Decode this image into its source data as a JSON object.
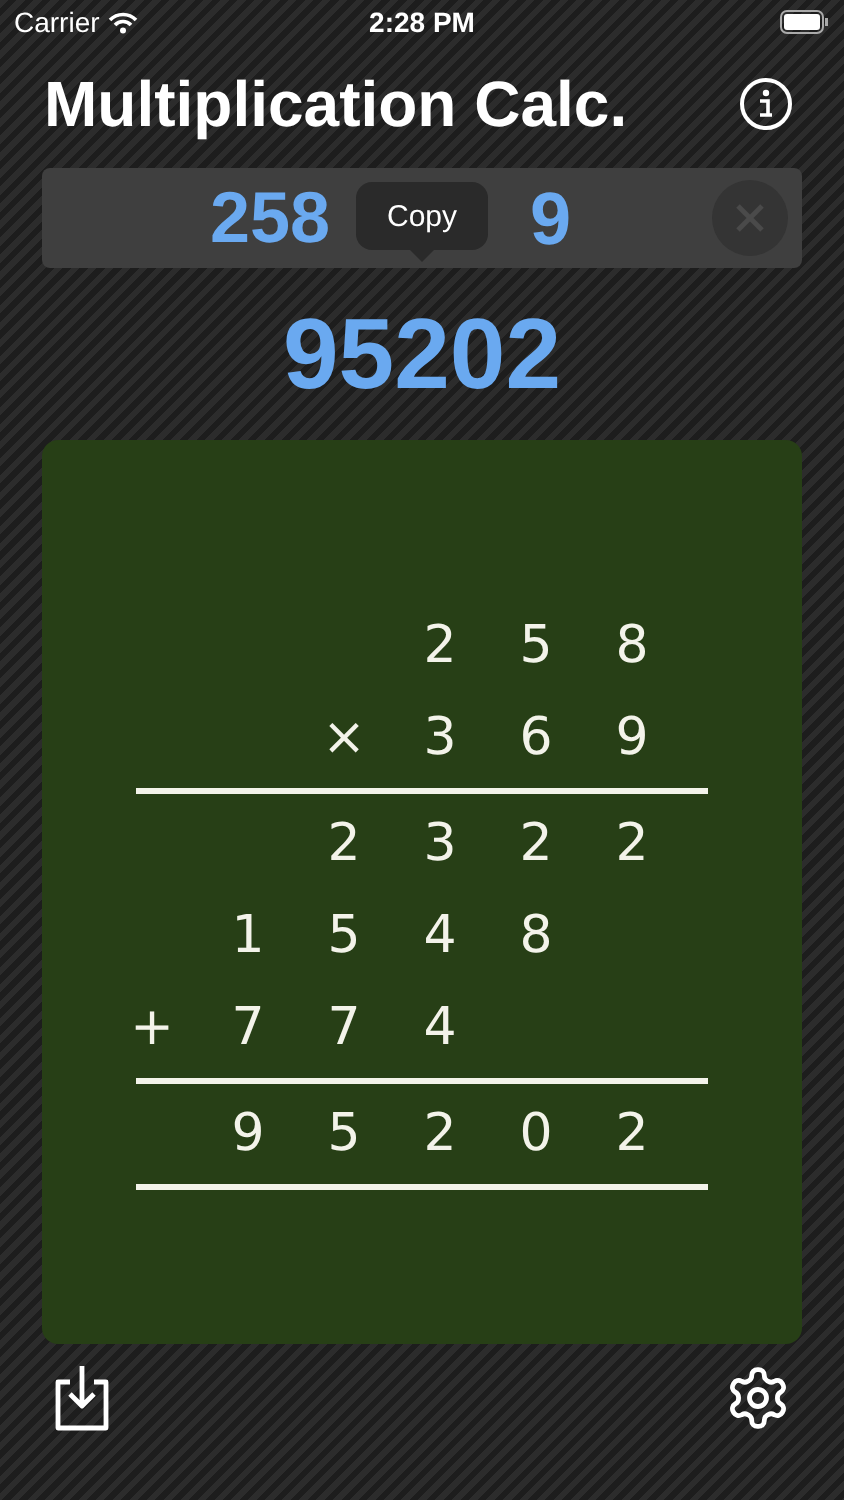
{
  "status_bar": {
    "carrier": "Carrier",
    "time": "2:28 PM"
  },
  "title": "Multiplication Calc.",
  "input": {
    "value_start": "258",
    "value_end": "9"
  },
  "tooltip": {
    "label": "Copy"
  },
  "result": "95202",
  "board": {
    "rows": [
      {
        "kind": "digits",
        "cells": [
          null,
          null,
          null,
          "2",
          "5",
          "8"
        ]
      },
      {
        "kind": "digits",
        "cells": [
          null,
          null,
          "×",
          "3",
          "6",
          "9"
        ]
      },
      {
        "kind": "rule"
      },
      {
        "kind": "digits",
        "cells": [
          null,
          null,
          "2",
          "3",
          "2",
          "2"
        ]
      },
      {
        "kind": "digits",
        "cells": [
          null,
          "1",
          "5",
          "4",
          "8",
          null
        ]
      },
      {
        "kind": "digits",
        "cells": [
          "+",
          "7",
          "7",
          "4",
          null,
          null
        ]
      },
      {
        "kind": "rule"
      },
      {
        "kind": "digits",
        "cells": [
          null,
          "9",
          "5",
          "2",
          "0",
          "2"
        ]
      },
      {
        "kind": "rule"
      }
    ]
  }
}
